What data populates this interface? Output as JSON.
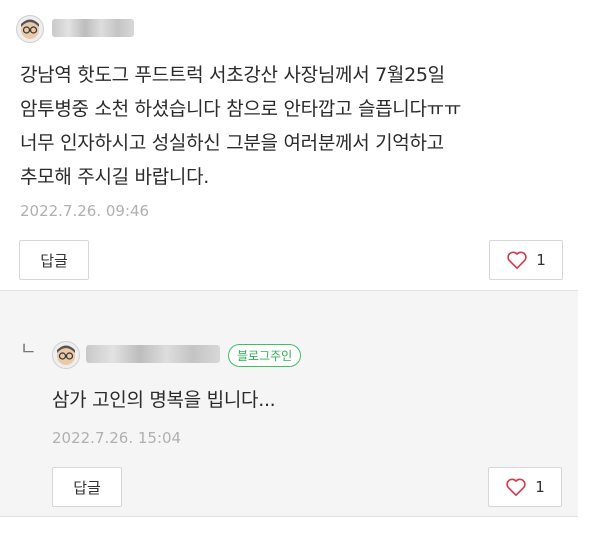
{
  "comments": [
    {
      "text_lines": [
        "강남역 핫도그 푸드트럭 서초강산 사장님께서 7월25일",
        "암투병중 소천 하셨습니다 참으로 안타깝고 슬픕니다ㅠㅠ",
        "너무 인자하시고 성실하신 그분을 여러분께서 기억하고",
        "추모해 주시길 바랍니다."
      ],
      "date": "2022.7.26. 09:46",
      "reply_label": "답글",
      "like_count": "1"
    }
  ],
  "reply": {
    "badge": "블로그주인",
    "text": "삼가 고인의 명복을 빕니다...",
    "date": "2022.7.26. 15:04",
    "reply_label": "답글",
    "like_count": "1",
    "reply_marker": "ㄴ"
  },
  "icons": {
    "heart": "heart-icon",
    "avatar": "avatar-icon"
  },
  "colors": {
    "badge_green": "#3fbf62",
    "heart_red": "#d23b4a",
    "date_gray": "#b0b0b0"
  }
}
